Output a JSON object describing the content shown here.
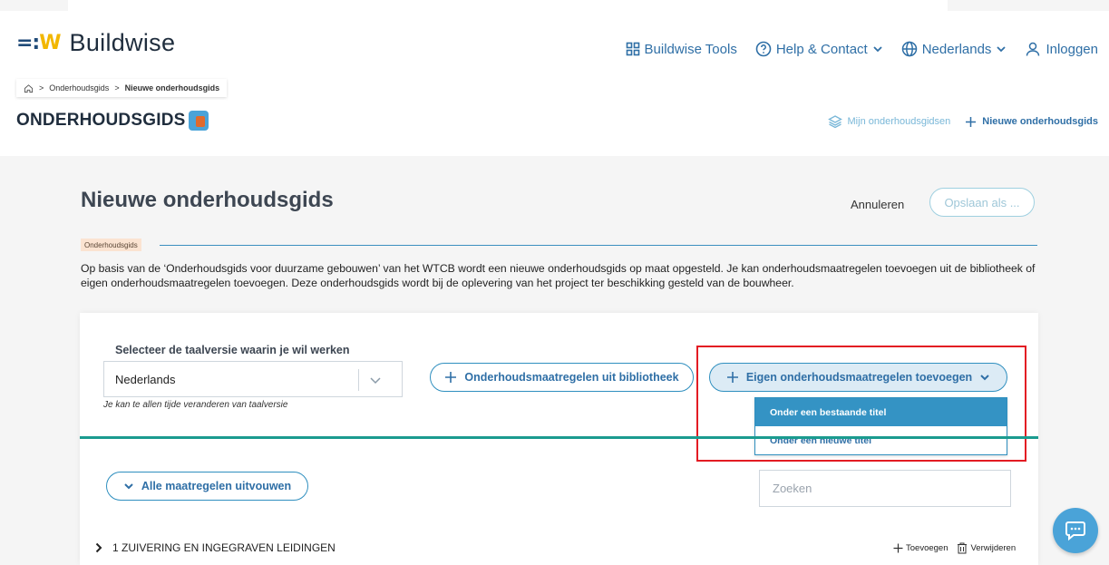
{
  "header": {
    "logo_mark_a": "=:",
    "logo_mark_b": "W",
    "logo_text": "Buildwise",
    "nav": {
      "tools": "Buildwise Tools",
      "help": "Help & Contact",
      "language": "Nederlands",
      "login": "Inloggen"
    },
    "breadcrumb": {
      "parent": "Onderhoudsgids",
      "current": "Nieuwe onderhoudsgids"
    },
    "brand": "ONDERHOUDSGIDS",
    "subnav": {
      "mine": "Mijn onderhoudsgidsen",
      "new": "Nieuwe onderhoudsgids"
    }
  },
  "main": {
    "title": "Nieuwe onderhoudsgids",
    "cancel_label": "Annuleren",
    "save_label": "Opslaan als ...",
    "tag": "Onderhoudsgids",
    "description": "Op basis van de ‘Onderhoudsgids voor duurzame gebouwen’ van het WTCB wordt een nieuwe onderhoudsgids op maat opgesteld. Je kan onderhoudsmaatregelen toevoegen uit de bibliotheek of eigen onderhoudsmaatregelen toevoegen. Deze onderhoudsgids wordt bij de oplevering van het project ter beschikking gesteld van de bouwheer."
  },
  "card": {
    "language_label": "Selecteer de taalversie waarin je wil werken",
    "language_value": "Nederlands",
    "language_hint": "Je kan te allen tijde veranderen van taalversie",
    "library_button": "Onderhoudsmaatregelen uit bibliotheek",
    "own_button": "Eigen onderhoudsmaatregelen toevoegen",
    "dropdown": {
      "existing": "Onder een bestaande titel",
      "new": "Onder een nieuwe titel"
    },
    "expand_button": "Alle maatregelen uitvouwen",
    "search_placeholder": "Zoeken",
    "section": {
      "title": "1 ZUIVERING EN INGEGRAVEN LEIDINGEN",
      "add": "Toevoegen",
      "remove": "Verwijderen"
    }
  },
  "colors": {
    "accent": "#2f6fa6",
    "teal": "#1a9b8f",
    "highlight": "#e31b23",
    "tag_bg": "#fbe3d1"
  }
}
